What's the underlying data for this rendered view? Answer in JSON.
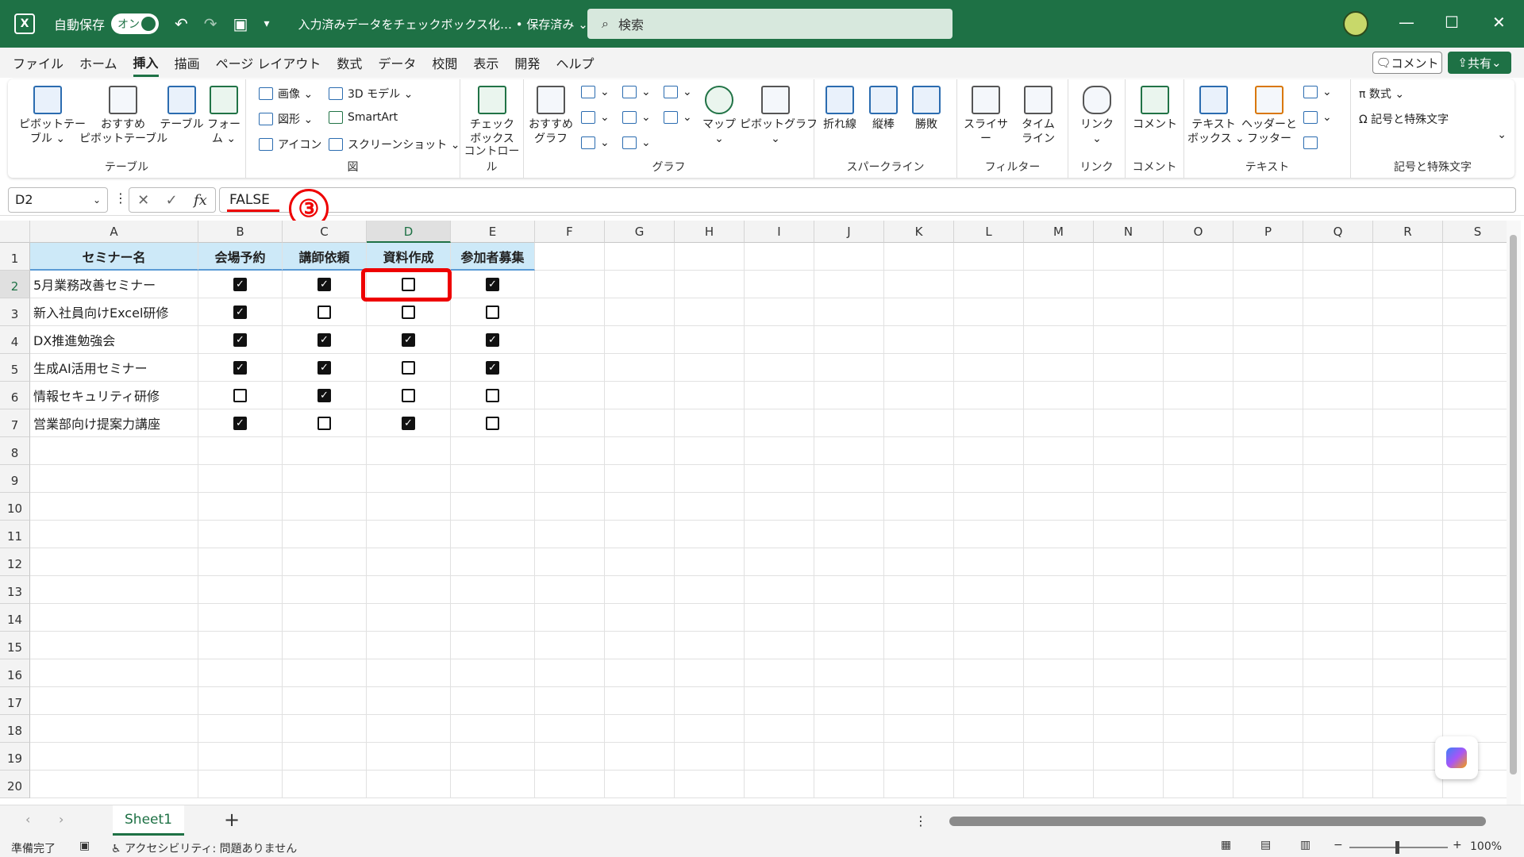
{
  "titlebar": {
    "autosave_label": "自動保存",
    "autosave_state": "オン",
    "doc_title": "入力済みデータをチェックボックス化…  •  保存済み ⌄",
    "search_placeholder": "検索"
  },
  "menu": [
    "ファイル",
    "ホーム",
    "挿入",
    "描画",
    "ページ レイアウト",
    "数式",
    "データ",
    "校閲",
    "表示",
    "開発",
    "ヘルプ"
  ],
  "menu_active_index": 2,
  "comment_label": "コメント",
  "share_label": "共有",
  "ribbon": {
    "groups": [
      "テーブル",
      "図",
      "コントロール",
      "グラフ",
      "スパークライン",
      "フィルター",
      "リンク",
      "コメント",
      "テキスト",
      "記号と特殊文字"
    ],
    "buttons": {
      "pivot": "ピボットテー\nブル ⌄",
      "rec_pivot": "おすすめ\nピボットテーブル",
      "table": "テーブル",
      "forms": "フォー\nム ⌄",
      "image": "画像 ⌄",
      "shapes": "図形 ⌄",
      "icons": "アイコン",
      "model3d": "3D モデル   ⌄",
      "smartart": "SmartArt",
      "screenshot": "スクリーンショット ⌄",
      "checkbox": "チェック\nボックス",
      "rec_chart": "おすすめ\nグラフ",
      "map": "マップ\n⌄",
      "pivot_chart": "ピボットグラフ\n⌄",
      "line": "折れ線",
      "column": "縦棒",
      "winloss": "勝敗",
      "slicer": "スライサー",
      "timeline": "タイム\nライン",
      "link": "リンク\n⌄",
      "comment": "コメント",
      "textbox": "テキスト\nボックス ⌄",
      "header_footer": "ヘッダーと\nフッター",
      "equation": "π 数式  ⌄",
      "symbol": "Ω 記号と特殊文字"
    }
  },
  "formula": {
    "namebox": "D2",
    "value": "FALSE",
    "step": "③"
  },
  "columns": [
    "A",
    "B",
    "C",
    "D",
    "E",
    "F",
    "G",
    "H",
    "I",
    "J",
    "K",
    "L",
    "M",
    "N",
    "O",
    "P",
    "Q",
    "R",
    "S"
  ],
  "rows": [
    "1",
    "2",
    "3",
    "4",
    "5",
    "6",
    "7",
    "8",
    "9",
    "10",
    "11",
    "12",
    "13",
    "14",
    "15",
    "16",
    "17",
    "18",
    "19",
    "20"
  ],
  "table": {
    "headers": [
      "セミナー名",
      "会場予約",
      "講師依頼",
      "資料作成",
      "参加者募集"
    ],
    "rows": [
      {
        "name": "5月業務改善セミナー",
        "checks": [
          true,
          true,
          false,
          true
        ]
      },
      {
        "name": "新入社員向けExcel研修",
        "checks": [
          true,
          false,
          false,
          false
        ]
      },
      {
        "name": "DX推進勉強会",
        "checks": [
          true,
          true,
          true,
          true
        ]
      },
      {
        "name": "生成AI活用セミナー",
        "checks": [
          true,
          true,
          false,
          true
        ]
      },
      {
        "name": "情報セキュリティ研修",
        "checks": [
          false,
          true,
          false,
          false
        ]
      },
      {
        "name": "営業部向け提案力講座",
        "checks": [
          true,
          false,
          true,
          false
        ]
      }
    ]
  },
  "sheet_tab": "Sheet1",
  "status": {
    "ready": "準備完了",
    "accessibility": "アクセシビリティ: 問題ありません",
    "zoom": "100%"
  }
}
